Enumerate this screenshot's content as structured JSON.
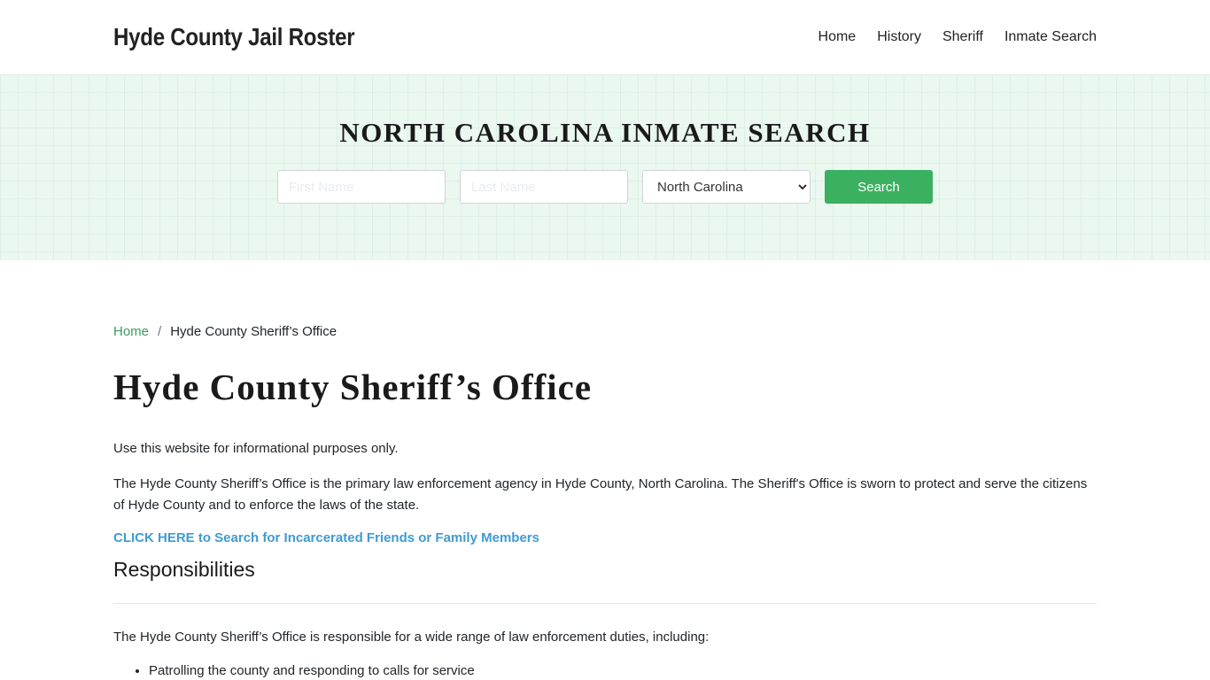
{
  "header": {
    "brand": "Hyde County Jail Roster",
    "nav": [
      {
        "label": "Home"
      },
      {
        "label": "History"
      },
      {
        "label": "Sheriff"
      },
      {
        "label": "Inmate Search"
      }
    ]
  },
  "hero": {
    "title": "NORTH CAROLINA INMATE SEARCH",
    "first_name_placeholder": "First Name",
    "last_name_placeholder": "Last Name",
    "state_selected": "North Carolina",
    "search_label": "Search",
    "accent_color": "#3cb061"
  },
  "breadcrumb": {
    "home": "Home",
    "separator": "/",
    "current": "Hyde County Sheriff’s Office"
  },
  "main": {
    "title": "Hyde County Sheriff’s Office",
    "disclaimer": "Use this website for informational purposes only.",
    "intro": "The Hyde County Sheriff’s Office is the primary law enforcement agency in Hyde County, North Carolina. The Sheriff's Office is sworn to protect and serve the citizens of Hyde County and to enforce the laws of the state.",
    "cta_link": "CLICK HERE to Search for Incarcerated Friends or Family Members",
    "responsibilities_heading": "Responsibilities",
    "responsibilities_intro": "The Hyde County Sheriff’s Office is responsible for a wide range of law enforcement duties, including:",
    "responsibilities": [
      "Patrolling the county and responding to calls for service"
    ]
  }
}
